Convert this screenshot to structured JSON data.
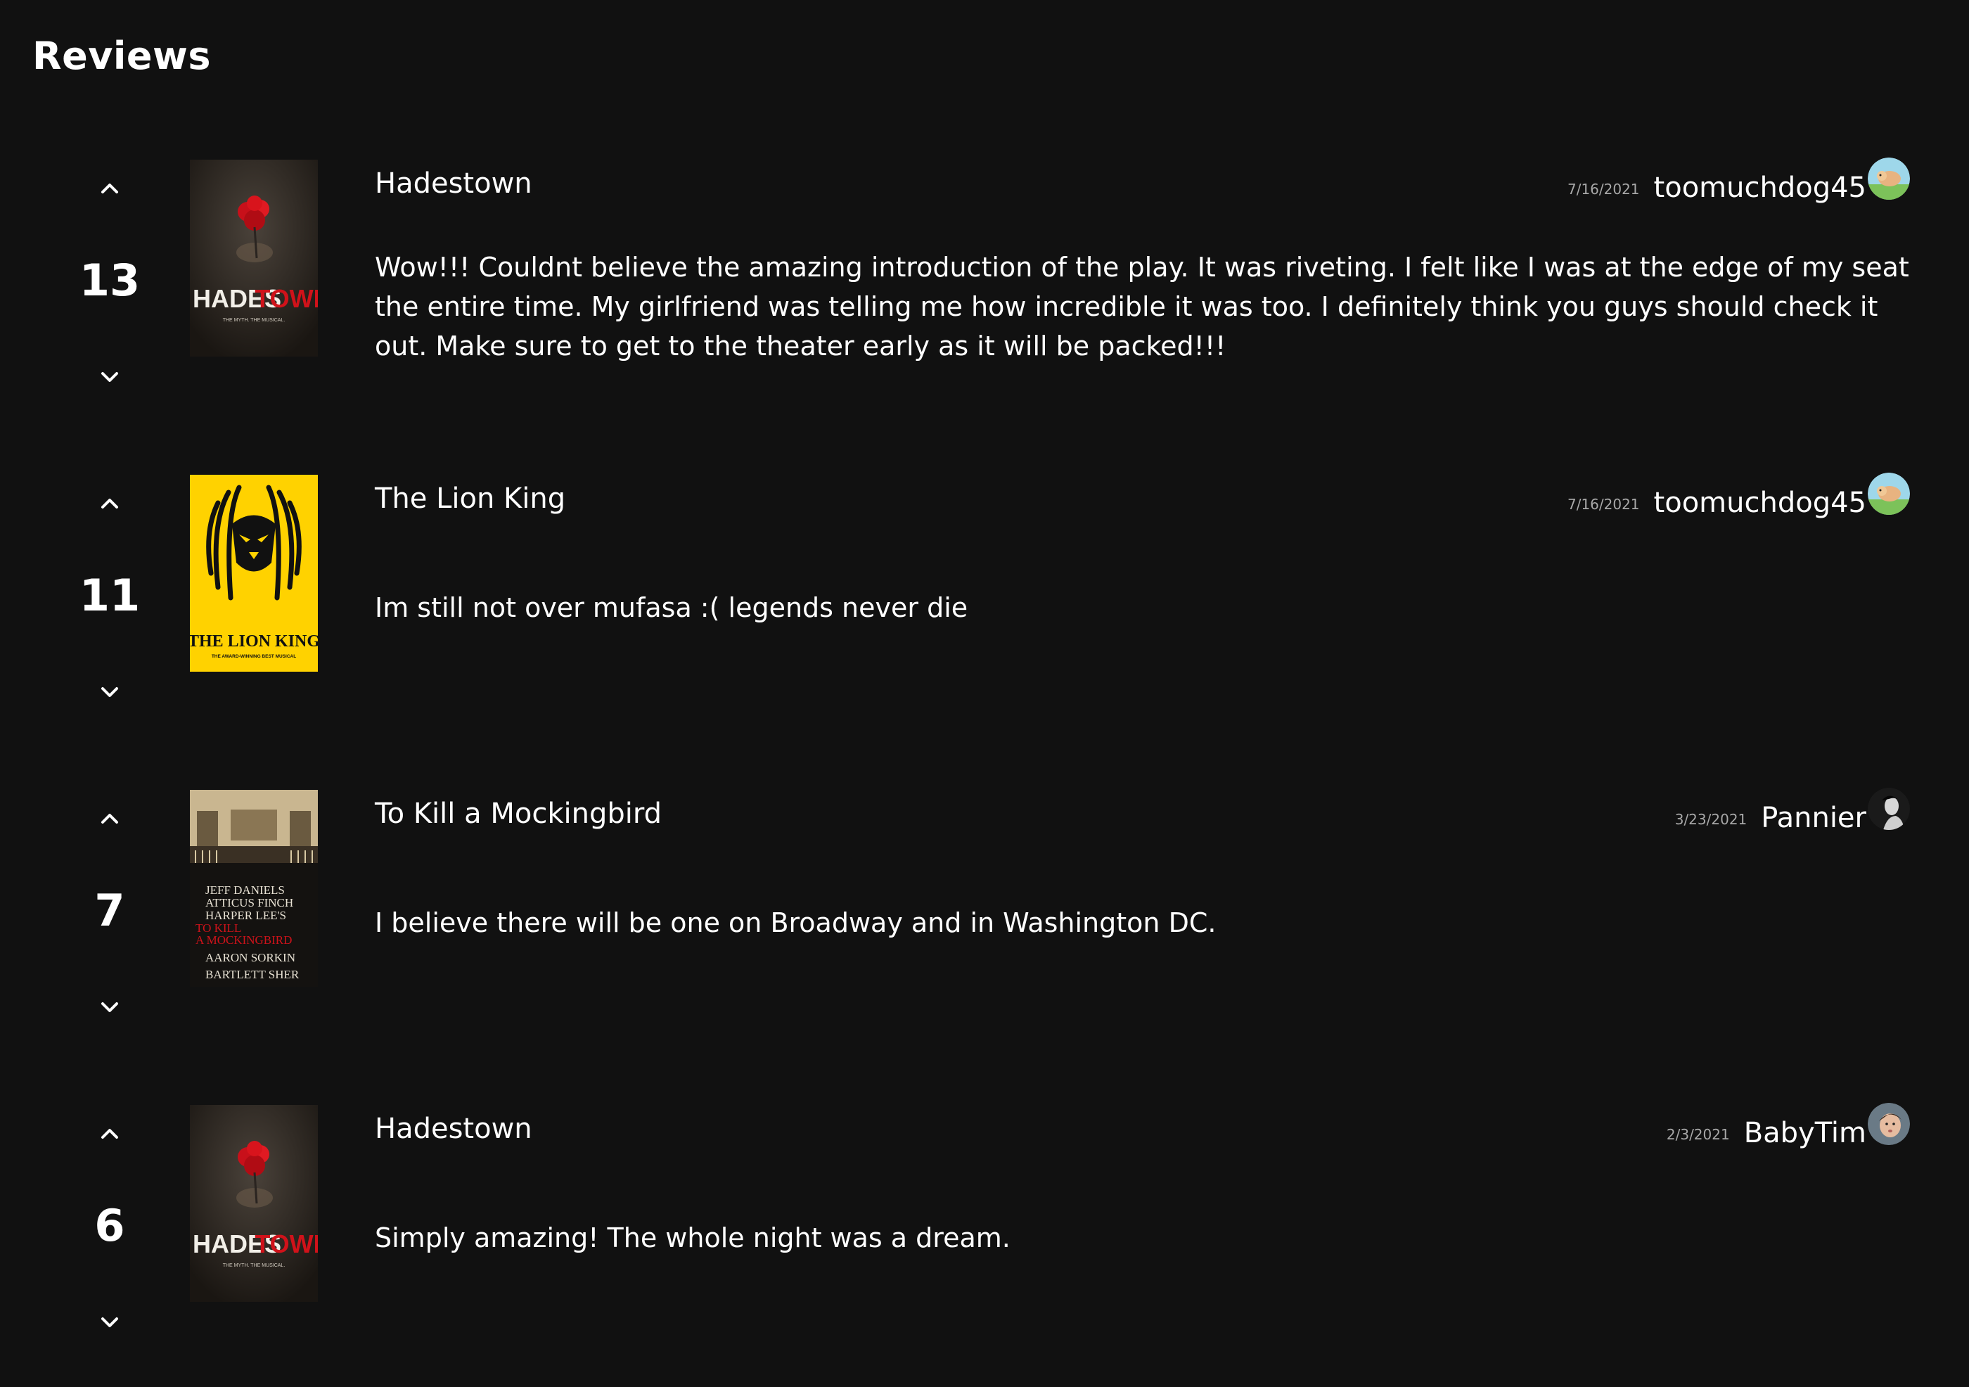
{
  "page": {
    "title": "Reviews"
  },
  "reviews": [
    {
      "votes": "13",
      "show": "Hadestown",
      "date": "7/16/2021",
      "user": "toomuchdog45",
      "text": "Wow!!! Couldnt believe the amazing introduction of the play. It was riveting. I felt like I was at the edge of my seat the entire time. My girlfriend was telling me how incredible it was too. I definitely think you guys should check it out. Make sure to get to the theater early as it will be packed!!!",
      "poster": {
        "name": "hadestown-poster",
        "headline_a": "HADES",
        "headline_b": "TOWN",
        "tagline": "THE MYTH. THE MUSICAL."
      },
      "avatar": "dog-avatar"
    },
    {
      "votes": "11",
      "show": "The Lion King",
      "date": "7/16/2021",
      "user": "toomuchdog45",
      "text": "Im still not over mufasa :( legends never die",
      "poster": {
        "name": "lion-king-poster",
        "headline": "THE LION KING",
        "tagline": "THE AWARD-WINNING BEST MUSICAL"
      },
      "avatar": "dog-avatar"
    },
    {
      "votes": "7",
      "show": "To Kill a Mockingbird",
      "date": "3/23/2021",
      "user": "Pannier",
      "text": "I believe there will be one on Broadway and in Washington DC.",
      "poster": {
        "name": "mockingbird-poster",
        "lines": [
          "JEFF DANIELS",
          "ATTICUS FINCH",
          "HARPER LEE'S",
          "TO KILL",
          "A MOCKINGBIRD",
          "AARON SORKIN",
          "BARTLETT SHER"
        ]
      },
      "avatar": "woman-portrait-avatar"
    },
    {
      "votes": "6",
      "show": "Hadestown",
      "date": "2/3/2021",
      "user": "BabyTim",
      "text": "Simply amazing! The whole night was a dream.",
      "poster": {
        "name": "hadestown-poster",
        "headline_a": "HADES",
        "headline_b": "TOWN",
        "tagline": "THE MYTH. THE MUSICAL."
      },
      "avatar": "baby-avatar"
    }
  ],
  "colors": {
    "background": "#111111",
    "text": "#ffffff",
    "muted": "#a8a8a8",
    "lion_yellow": "#ffd200",
    "hades_red": "#d0121a"
  }
}
